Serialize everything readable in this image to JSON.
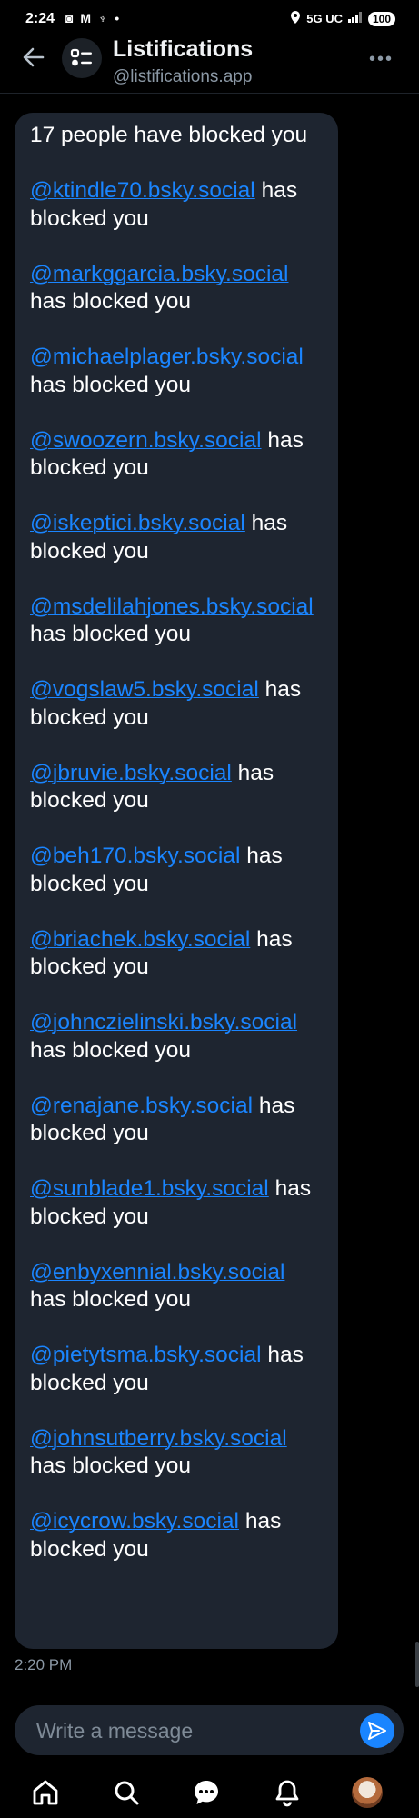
{
  "status": {
    "time": "2:24",
    "left_icons": "◙ M ♆ •",
    "network": "5G UC",
    "battery": "100"
  },
  "header": {
    "title": "Listifications",
    "handle": "@listifications.app"
  },
  "message": {
    "intro": "17 people have blocked you",
    "suffix": "has blocked you",
    "items": [
      {
        "handle": "@ktindle70.bsky.social"
      },
      {
        "handle": "@markggarcia.bsky.social"
      },
      {
        "handle": "@michaelplager.bsky.social"
      },
      {
        "handle": "@swoozern.bsky.social"
      },
      {
        "handle": "@iskeptici.bsky.social"
      },
      {
        "handle": "@msdelilahjones.bsky.social"
      },
      {
        "handle": "@vogslaw5.bsky.social"
      },
      {
        "handle": "@jbruvie.bsky.social"
      },
      {
        "handle": "@beh170.bsky.social"
      },
      {
        "handle": "@briachek.bsky.social"
      },
      {
        "handle": "@johnczielinski.bsky.social"
      },
      {
        "handle": "@renajane.bsky.social"
      },
      {
        "handle": "@sunblade1.bsky.social"
      },
      {
        "handle": "@enbyxennial.bsky.social"
      },
      {
        "handle": "@pietytsma.bsky.social"
      },
      {
        "handle": "@johnsutberry.bsky.social"
      },
      {
        "handle": "@icycrow.bsky.social"
      }
    ],
    "time": "2:20 PM"
  },
  "composer": {
    "placeholder": "Write a message"
  },
  "nav": [
    "home-icon",
    "search-icon",
    "chat-icon",
    "bell-icon",
    "profile-avatar"
  ],
  "colors": {
    "background": "#000000",
    "bubble": "#1e2530",
    "link": "#1a85ff",
    "muted": "#8b98a5",
    "accent": "#1a85ff"
  }
}
